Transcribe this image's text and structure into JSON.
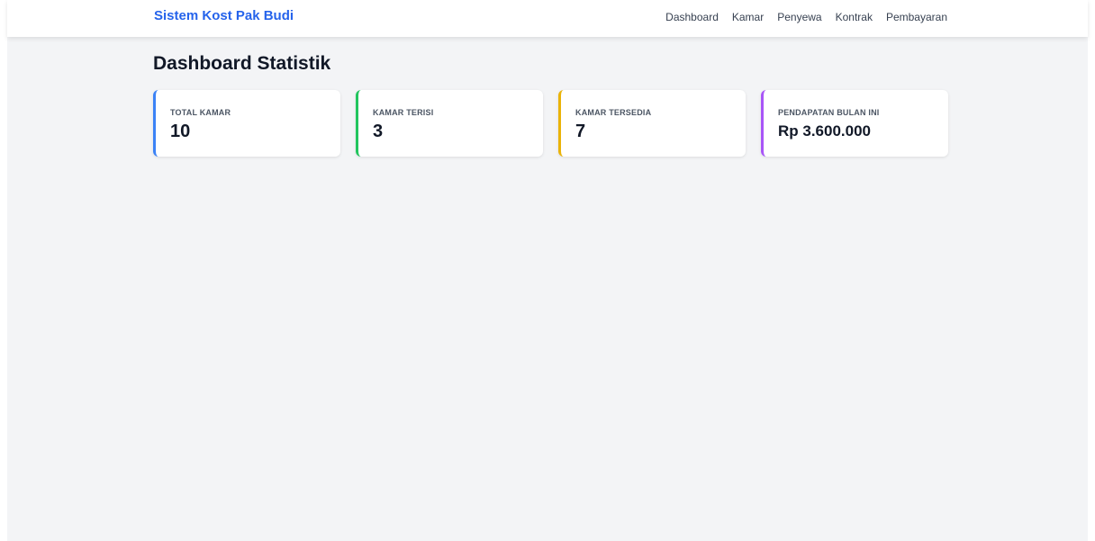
{
  "app": {
    "brand": "Sistem Kost Pak Budi"
  },
  "nav": {
    "items": [
      "Dashboard",
      "Kamar",
      "Penyewa",
      "Kontrak",
      "Pembayaran"
    ]
  },
  "page": {
    "title": "Dashboard Statistik"
  },
  "stats": [
    {
      "label": "TOTAL KAMAR",
      "value": "10",
      "accent": "#3b82f6"
    },
    {
      "label": "KAMAR TERISI",
      "value": "3",
      "accent": "#22c55e"
    },
    {
      "label": "KAMAR TERSEDIA",
      "value": "7",
      "accent": "#eab308"
    },
    {
      "label": "PENDAPATAN BULAN INI",
      "value": "Rp 3.600.000",
      "accent": "#a855f7"
    }
  ],
  "colors": {
    "brand": "#2563eb",
    "background": "#f3f4f6"
  }
}
